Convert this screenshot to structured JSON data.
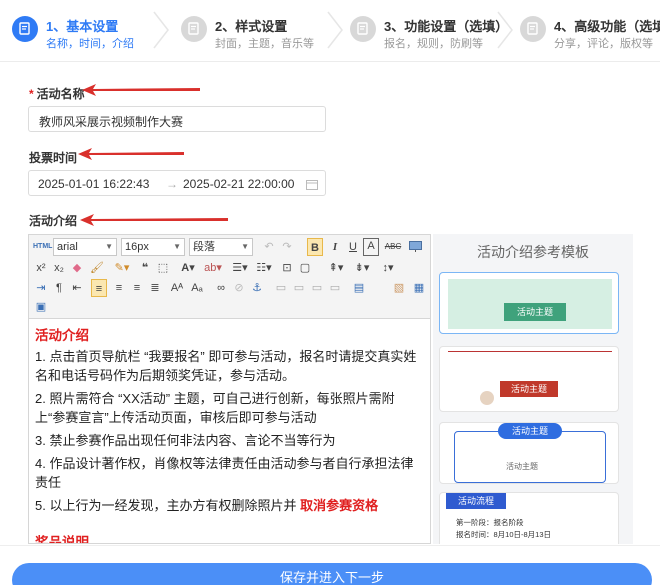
{
  "steps": [
    {
      "title": "1、基本设置",
      "sub": "名称，时间，介绍"
    },
    {
      "title": "2、样式设置",
      "sub": "封面，主题，音乐等"
    },
    {
      "title": "3、功能设置（选填）",
      "sub": "报名，规则，防刷等"
    },
    {
      "title": "4、高级功能（选填）",
      "sub": "分享，评论，版权等"
    }
  ],
  "form": {
    "name_label": "活动名称",
    "name_required_mark": "*",
    "name_value": "教师风采展示视频制作大赛",
    "vote_time_label": "投票时间",
    "start_time": "2025-01-01 16:22:43",
    "range_arrow": "→",
    "end_time": "2025-02-21 22:00:00",
    "intro_label": "活动介绍"
  },
  "toolbar": {
    "html_label": "HTML",
    "font_family": "arial",
    "font_size": "16px",
    "paragraph": "段落",
    "bold": "B",
    "italic": "I",
    "underline": "U",
    "font_border": "A",
    "strike": "ABC"
  },
  "content": {
    "heading": "活动介绍",
    "items": [
      "1. 点击首页导航栏 “我要报名” 即可参与活动，报名时请提交真实姓名和电话号码作为后期领奖凭证，参与活动。",
      "2. 照片需符合 “XX活动” 主题，可自己进行创新，每张照片需附上“参赛宣言”上传活动页面，审核后即可参与活动",
      "3. 禁止参赛作品出现任何非法内容、言论不当等行为",
      "4. 作品设计著作权，肖像权等法律责任由活动参与者自行承担法律责任"
    ],
    "item5_prefix": "5. 以上行为一经发现，主办方有权删除照片并",
    "item5_emphasis": "取消参赛资格",
    "heading2": "奖品说明"
  },
  "templates": {
    "title": "活动介绍参考模板",
    "card1_tag": "活动主题",
    "card2_tag": "活动主题",
    "card3_header": "活动主题",
    "card3_inner": "活动主题",
    "card4_tag": "活动流程",
    "card4_line1": "第一阶段：报名阶段",
    "card4_line2": "报名时间：8月10日-8月13日"
  },
  "save_button": "保存并进入下一步",
  "colors": {
    "accent": "#2f7bf5",
    "required": "#e02020",
    "arrow": "#d9302c",
    "button": "#4b8ff7"
  }
}
